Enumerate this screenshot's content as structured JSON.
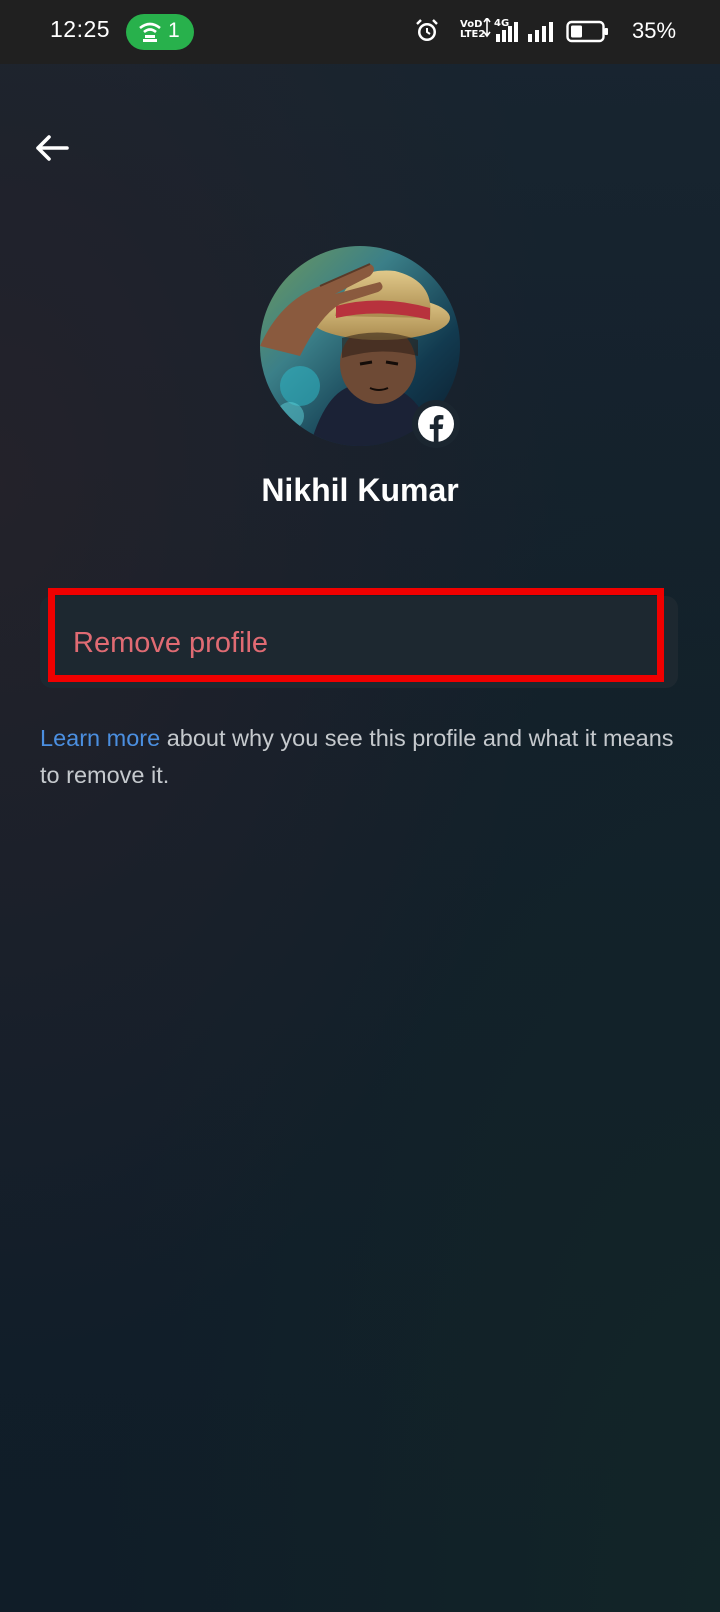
{
  "status_bar": {
    "time": "12:25",
    "hotspot_count": "1",
    "network_lte": "VoD LTE2",
    "network_type": "4G",
    "battery_percent": "35%",
    "battery_level": 0.35,
    "colors": {
      "hotspot": "#28b14c",
      "background": "#202020"
    }
  },
  "header": {
    "back_icon": "arrow-left-icon"
  },
  "profile": {
    "name": "Nikhil Kumar",
    "avatar_icon": "profile-avatar",
    "badge_icon": "facebook-icon"
  },
  "actions": {
    "remove_label": "Remove profile",
    "highlight_color": "#f00000",
    "remove_color": "#e06b73"
  },
  "info": {
    "link_text": "Learn more",
    "body_text": " about why you see this profile and what it means to remove it.",
    "link_color": "#4b8fe0"
  }
}
